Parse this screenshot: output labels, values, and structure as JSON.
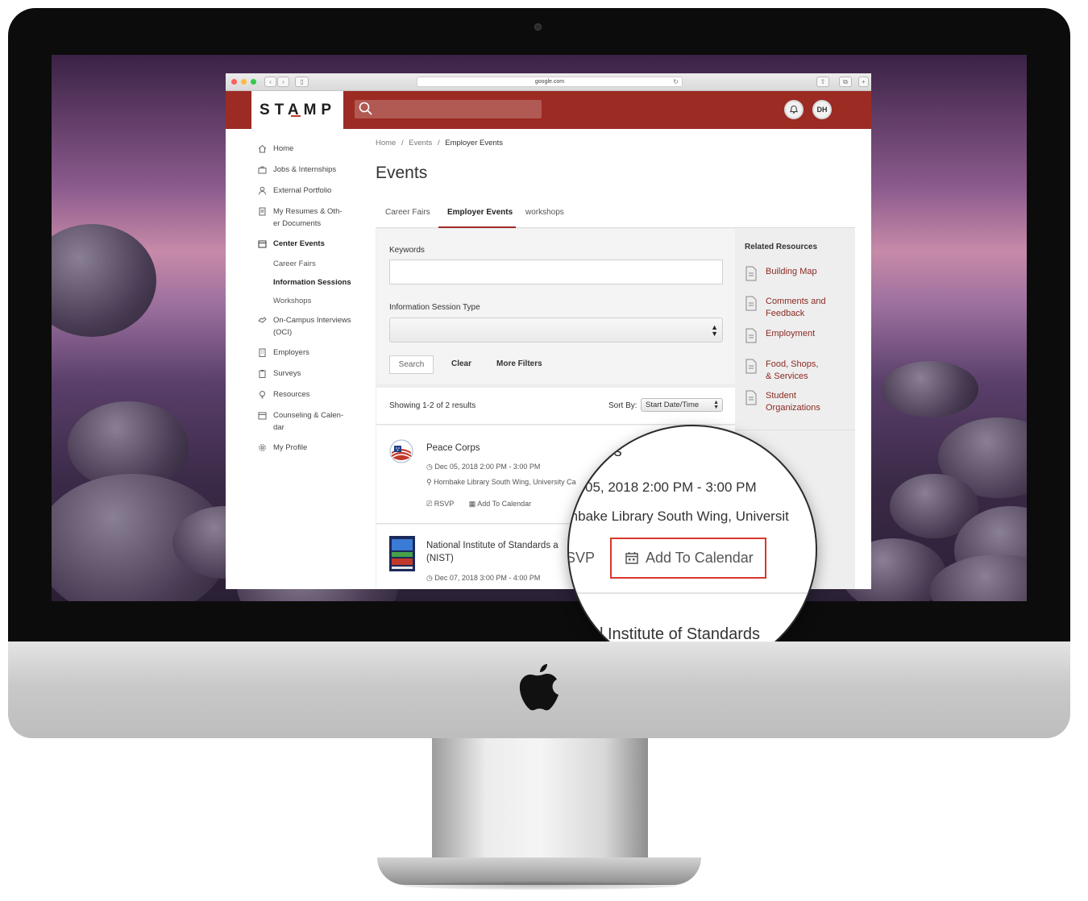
{
  "browser": {
    "url": "google.com"
  },
  "app": {
    "logo": "STAMP",
    "user_initials": "DH",
    "icons": {
      "search": "search-icon",
      "notifications": "bell-icon"
    },
    "brand_color": "#9c2b23"
  },
  "sidebar": {
    "items": [
      {
        "label": "Home",
        "icon": "home-icon"
      },
      {
        "label": "Jobs & Internships",
        "icon": "briefcase-icon"
      },
      {
        "label": "External Portfolio",
        "icon": "person-icon"
      },
      {
        "label": "My Resumes & Oth-",
        "label2": "er Documents",
        "icon": "document-icon"
      },
      {
        "label": "Center Events",
        "icon": "calendar-icon"
      },
      {
        "label": "On-Campus Interviews",
        "label2": "(OCI)",
        "icon": "handshake-icon"
      },
      {
        "label": "Employers",
        "icon": "building-icon"
      },
      {
        "label": "Surveys",
        "icon": "clipboard-icon"
      },
      {
        "label": "Resources",
        "icon": "lightbulb-icon"
      },
      {
        "label": "Counseling & Calen-",
        "label2": "dar",
        "icon": "calendar-icon"
      },
      {
        "label": "My Profile",
        "icon": "gear-icon"
      }
    ],
    "subitems": [
      "Career Fairs",
      "Information Sessions",
      "Workshops"
    ]
  },
  "breadcrumb": [
    "Home",
    "Events",
    "Employer Events"
  ],
  "breadcrumb_sep": "/",
  "page_title": "Events",
  "tabs": [
    "Career Fairs",
    "Employer Events",
    "workshops"
  ],
  "filters": {
    "keywords_label": "Keywords",
    "keywords_value": "",
    "session_type_label": "Information Session Type",
    "session_type_value": "",
    "search_button": "Search",
    "clear_button": "Clear",
    "more_filters": "More Filters"
  },
  "results": {
    "count_text": "Showing 1-2 of 2 results",
    "sort_label": "Sort By:",
    "sort_value": "Start Date/Time"
  },
  "events": [
    {
      "title": "Peace Corps",
      "datetime": "Dec 05, 2018 2:00 PM - 3:00 PM",
      "location": "Hornbake Library South Wing, University Ca",
      "rsvp": "RSVP",
      "add_to_calendar": "Add To Calendar"
    },
    {
      "title": "National Institute of Standards a",
      "title2": "(NIST)",
      "datetime": "Dec 07, 2018 3:00 PM - 4:00 PM"
    }
  ],
  "related": {
    "title": "Related Resources",
    "items": [
      {
        "label": "Building Map"
      },
      {
        "label": "Comments and",
        "label2": "Feedback"
      },
      {
        "label": "Employment"
      },
      {
        "label": "Food, Shops,",
        "label2": "& Services"
      },
      {
        "label": "Student",
        "label2": "Organizations"
      }
    ]
  },
  "magnifier": {
    "title_fragment": "rps",
    "datetime_fragment": "05, 2018 2:00 PM - 3:00 PM",
    "location_fragment": "rnbake Library South Wing, Universit",
    "rsvp_fragment": "SVP",
    "add_to_calendar": "Add To Calendar",
    "next_title_fragment": "l Institute of Standards",
    "highlight_color": "#d9372b"
  }
}
